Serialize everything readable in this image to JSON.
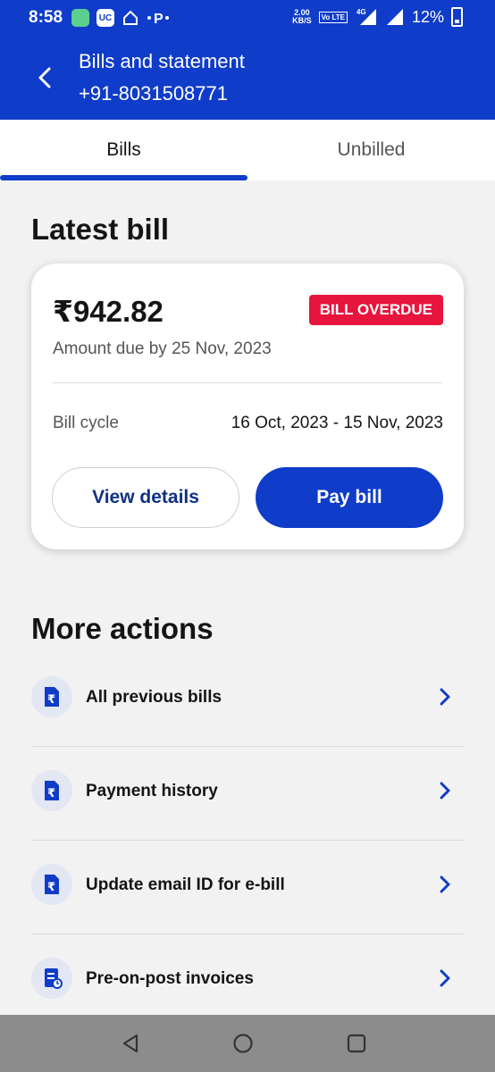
{
  "status_bar": {
    "time": "8:58",
    "speed_top": "2.00",
    "speed_unit": "KB/S",
    "volte": "Vo LTE",
    "network": "4G",
    "battery": "12%",
    "uc_label": "UC"
  },
  "app_bar": {
    "title": "Bills and statement",
    "subtitle": "+91-8031508771"
  },
  "tabs": [
    {
      "label": "Bills",
      "selected": true
    },
    {
      "label": "Unbilled",
      "selected": false
    }
  ],
  "latest_bill": {
    "heading": "Latest bill",
    "amount": "₹942.82",
    "status_badge": "BILL OVERDUE",
    "due_text": "Amount due by 25 Nov, 2023",
    "cycle_label": "Bill cycle",
    "cycle_value": "16 Oct, 2023 - 15 Nov, 2023",
    "view_details_label": "View details",
    "pay_bill_label": "Pay bill"
  },
  "more_actions": {
    "heading": "More actions",
    "items": [
      {
        "label": "All previous bills",
        "icon": "rupee-document-icon"
      },
      {
        "label": "Payment history",
        "icon": "rupee-document-icon"
      },
      {
        "label": "Update email ID for e-bill",
        "icon": "rupee-document-icon"
      },
      {
        "label": "Pre-on-post invoices",
        "icon": "invoice-icon"
      }
    ]
  },
  "colors": {
    "brand_blue": "#0f3cc9",
    "overdue_red": "#e7143d",
    "text_dark": "#141414",
    "text_muted": "#555555"
  }
}
